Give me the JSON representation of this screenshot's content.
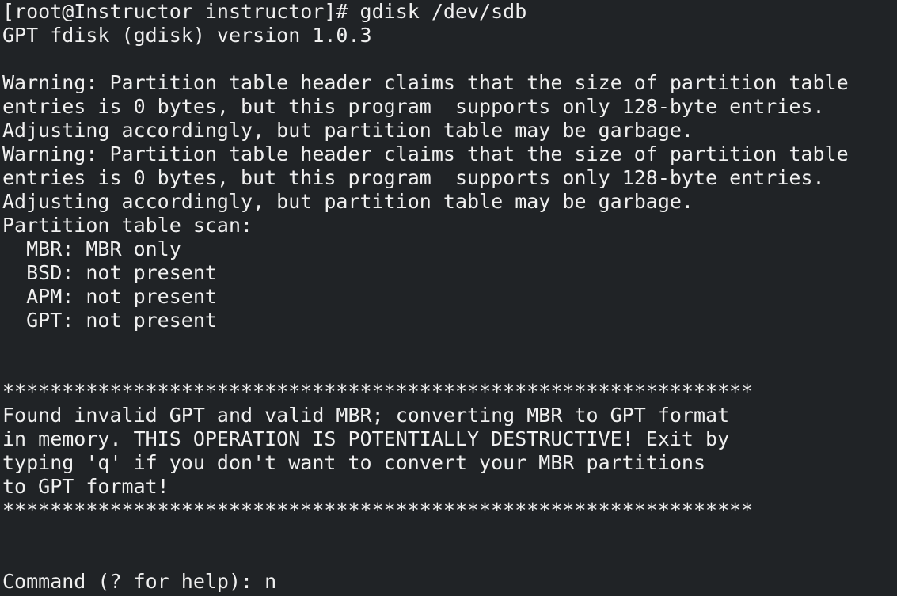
{
  "terminal": {
    "lines": [
      "[root@Instructor instructor]# gdisk /dev/sdb",
      "GPT fdisk (gdisk) version 1.0.3",
      "",
      "Warning: Partition table header claims that the size of partition table",
      "entries is 0 bytes, but this program  supports only 128-byte entries.",
      "Adjusting accordingly, but partition table may be garbage.",
      "Warning: Partition table header claims that the size of partition table",
      "entries is 0 bytes, but this program  supports only 128-byte entries.",
      "Adjusting accordingly, but partition table may be garbage.",
      "Partition table scan:",
      "  MBR: MBR only",
      "  BSD: not present",
      "  APM: not present",
      "  GPT: not present",
      "",
      "",
      "***************************************************************",
      "Found invalid GPT and valid MBR; converting MBR to GPT format",
      "in memory. THIS OPERATION IS POTENTIALLY DESTRUCTIVE! Exit by",
      "typing 'q' if you don't want to convert your MBR partitions",
      "to GPT format!",
      "***************************************************************",
      "",
      "",
      "Command (? for help): n"
    ]
  },
  "colors": {
    "background": "#202326",
    "foreground": "#f0f0f0"
  }
}
